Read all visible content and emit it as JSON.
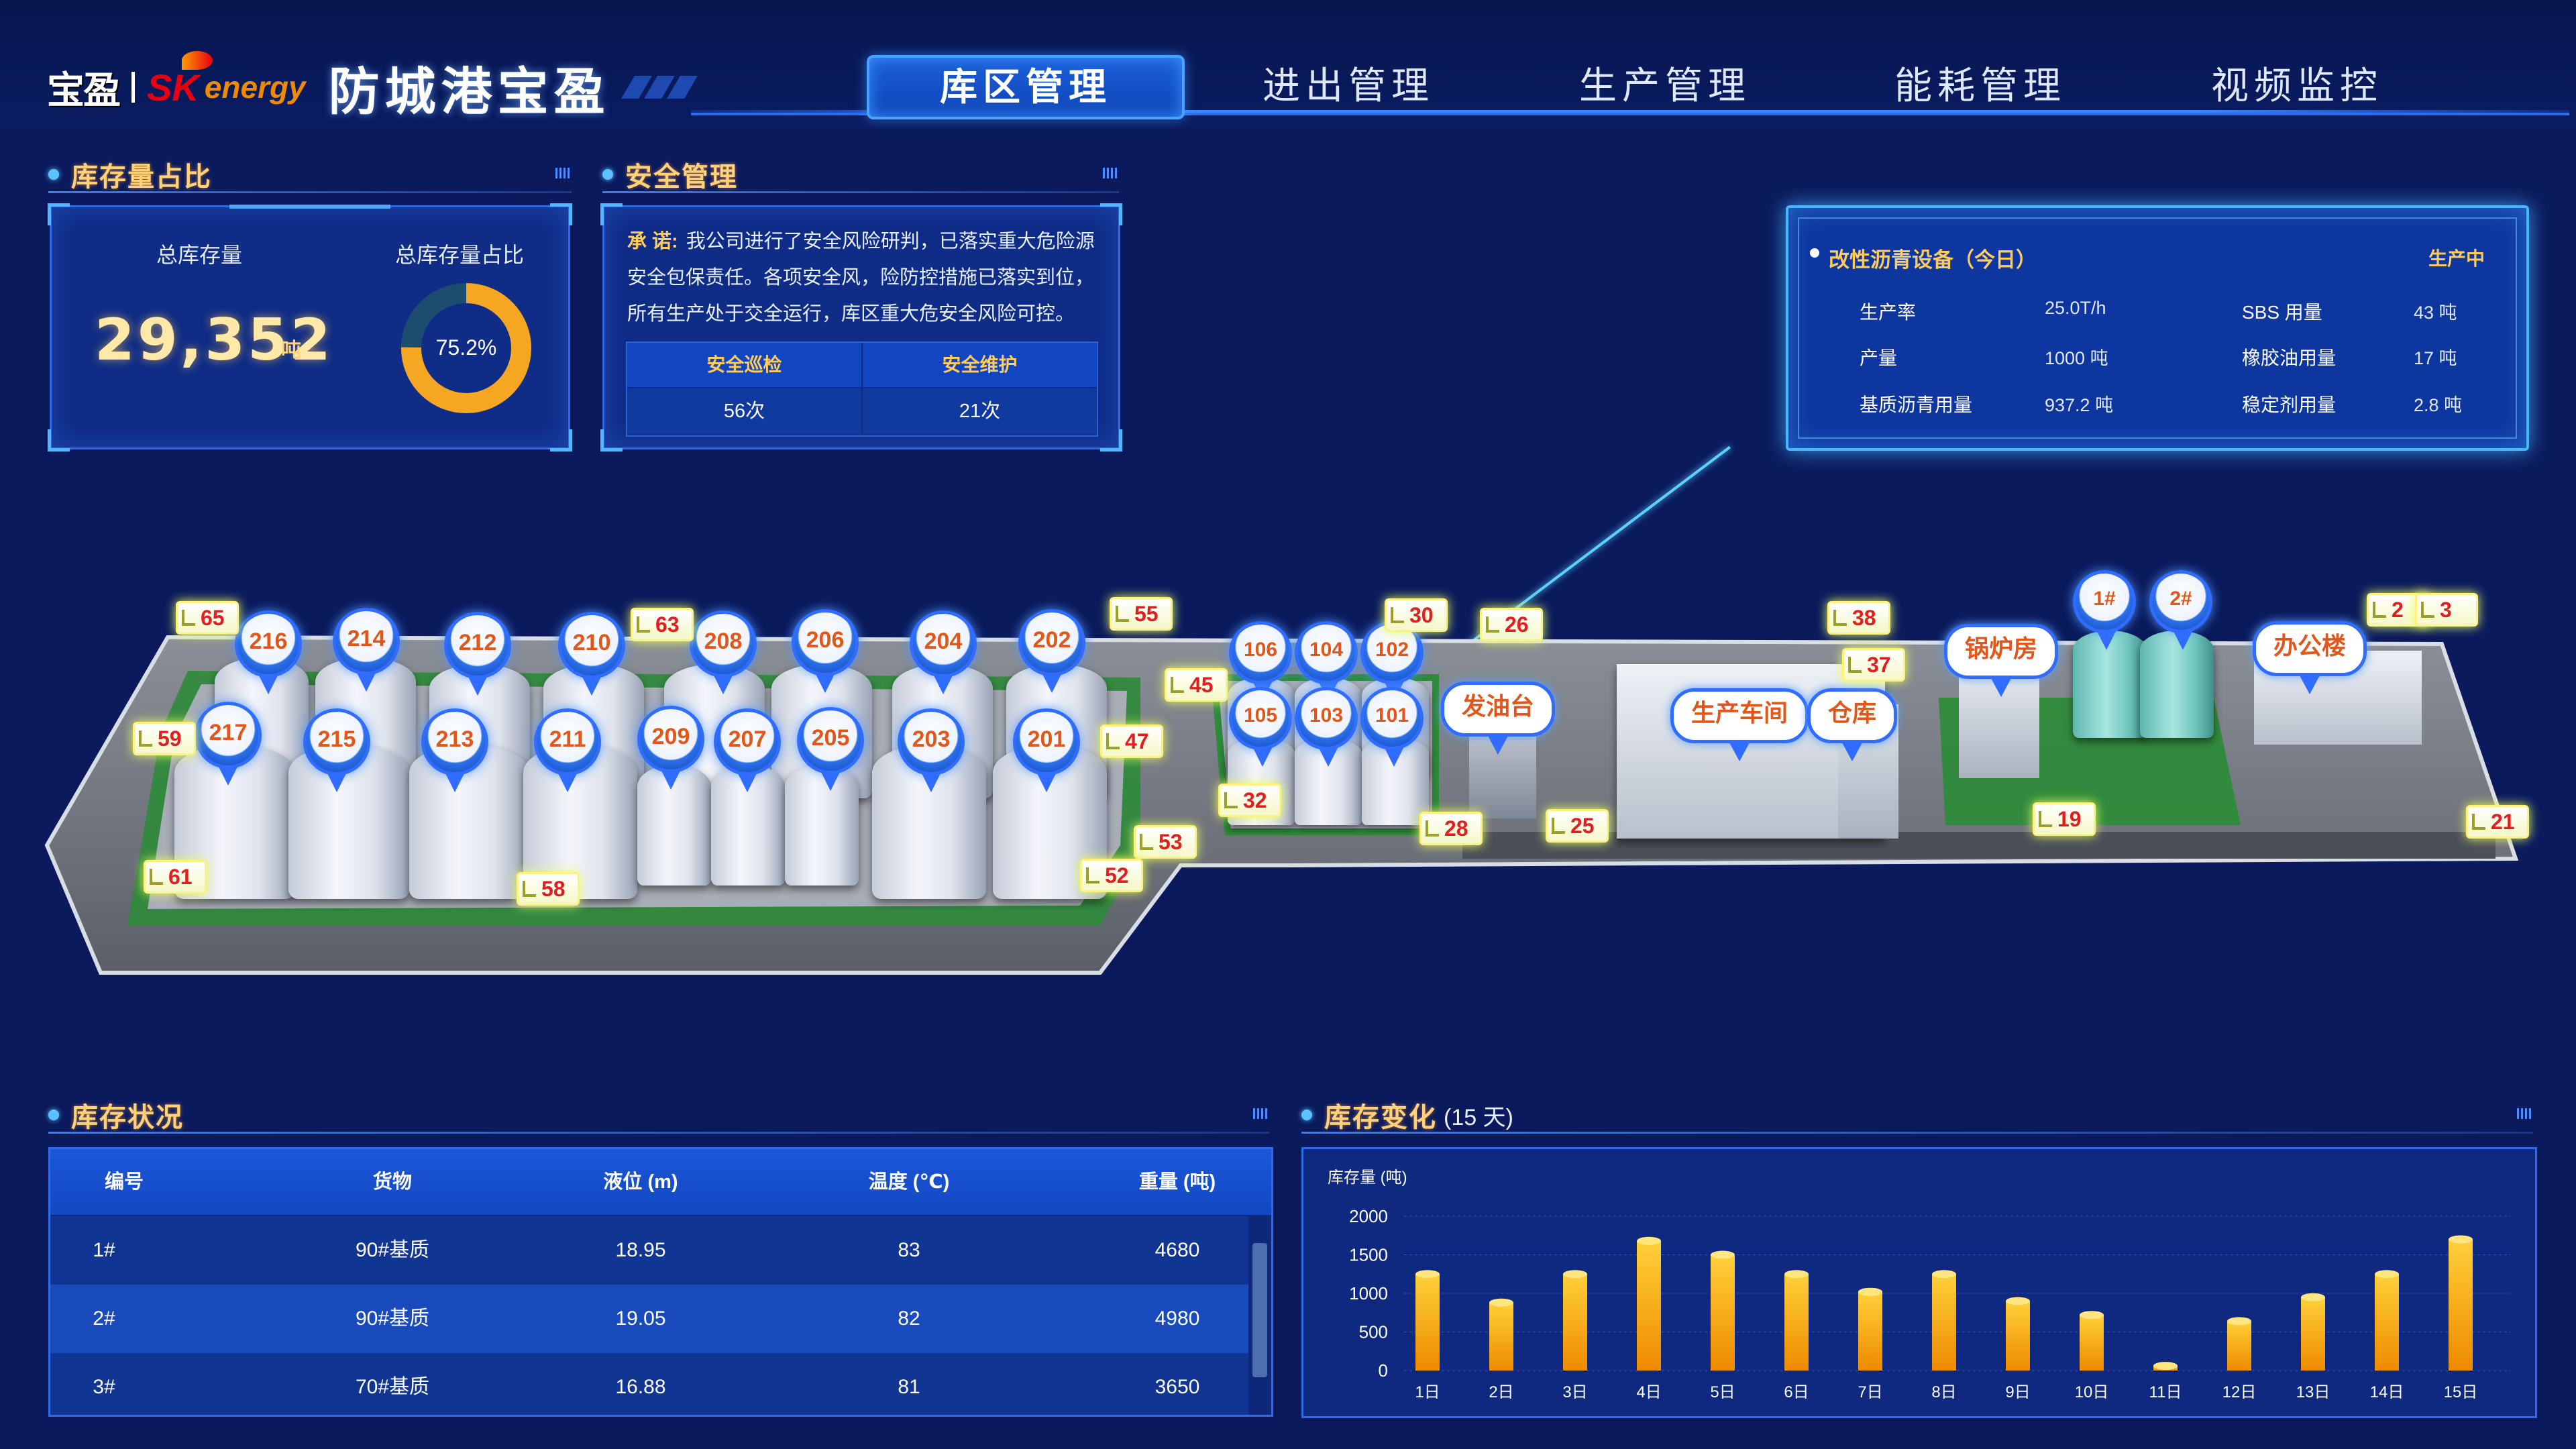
{
  "header": {
    "logo_bao": "宝盈",
    "logo_sk": "SK",
    "logo_energy": "energy",
    "title": "防城港宝盈",
    "nav": [
      {
        "label": "库区管理",
        "active": true
      },
      {
        "label": "进出管理",
        "active": false
      },
      {
        "label": "生产管理",
        "active": false
      },
      {
        "label": "能耗管理",
        "active": false
      },
      {
        "label": "视频监控",
        "active": false
      }
    ]
  },
  "inventory_ratio": {
    "title": "库存量占比",
    "total_label": "总库存量",
    "total_value": "29,352",
    "unit": "吨",
    "ratio_label": "总库存量占比",
    "ratio_text": "75.2%",
    "ratio_value": 0.752,
    "colors": {
      "ring": "#f5a623",
      "track": "#1c4d6e"
    }
  },
  "safety": {
    "title": "安全管理",
    "promise_lead": "承  诺:",
    "promise_text": "我公司进行了安全风险研判，已落实重大危险源安全包保责任。各项安全风，险防控措施已落实到位，所有生产处于交全运行，库区重大危安全风险可控。",
    "patrol_label": "安全巡检",
    "patrol_value": "56次",
    "maint_label": "安全维护",
    "maint_value": "21次"
  },
  "equipment": {
    "title": "改性沥青设备（今日）",
    "status": "生产中",
    "rows": [
      {
        "label": "生产率",
        "value": "25.0T/h",
        "label2": "SBS 用量",
        "value2": "43 吨"
      },
      {
        "label": "产量",
        "value": "1000 吨",
        "label2": "橡胶油用量",
        "value2": "17 吨"
      },
      {
        "label": "基质沥青用量",
        "value": "937.2 吨",
        "label2": "稳定剂用量",
        "value2": "2.8 吨"
      }
    ]
  },
  "map": {
    "tank_markers": [
      "216",
      "214",
      "212",
      "210",
      "208",
      "206",
      "204",
      "202",
      "217",
      "215",
      "213",
      "211",
      "209",
      "207",
      "205",
      "203",
      "201",
      "106",
      "104",
      "102",
      "105",
      "103",
      "101",
      "1#",
      "2#"
    ],
    "building_labels": [
      "发油台",
      "生产车间",
      "仓库",
      "锅炉房",
      "办公楼"
    ],
    "cameras": [
      "65",
      "63",
      "55",
      "30",
      "26",
      "38",
      "37",
      "2",
      "3",
      "59",
      "45",
      "47",
      "32",
      "53",
      "52",
      "28",
      "25",
      "19",
      "21",
      "61",
      "58"
    ]
  },
  "inventory_status": {
    "title": "库存状况",
    "columns": [
      "编号",
      "货物",
      "液位 (m)",
      "温度 (℃)",
      "重量 (吨)"
    ],
    "rows": [
      [
        "1#",
        "90#基质",
        "18.95",
        "83",
        "4680"
      ],
      [
        "2#",
        "90#基质",
        "19.05",
        "82",
        "4980"
      ],
      [
        "3#",
        "70#基质",
        "16.88",
        "81",
        "3650"
      ]
    ]
  },
  "inventory_change": {
    "title": "库存变化",
    "subtitle": "(15 天)"
  },
  "chart_data": {
    "type": "bar",
    "title": "",
    "ylabel": "库存量 (吨)",
    "xlabel": "",
    "categories": [
      "1日",
      "2日",
      "3日",
      "4日",
      "5日",
      "6日",
      "7日",
      "8日",
      "9日",
      "10日",
      "11日",
      "12日",
      "13日",
      "14日",
      "15日"
    ],
    "values": [
      1250,
      880,
      1250,
      1680,
      1500,
      1250,
      1020,
      1250,
      900,
      720,
      60,
      640,
      950,
      1250,
      1700
    ],
    "ylim": [
      0,
      2000
    ],
    "yticks": [
      0,
      500,
      1000,
      1500,
      2000
    ],
    "grid": true,
    "colors": {
      "bar_top": "#ffd03a",
      "bar_bottom": "#ee8a00"
    }
  }
}
